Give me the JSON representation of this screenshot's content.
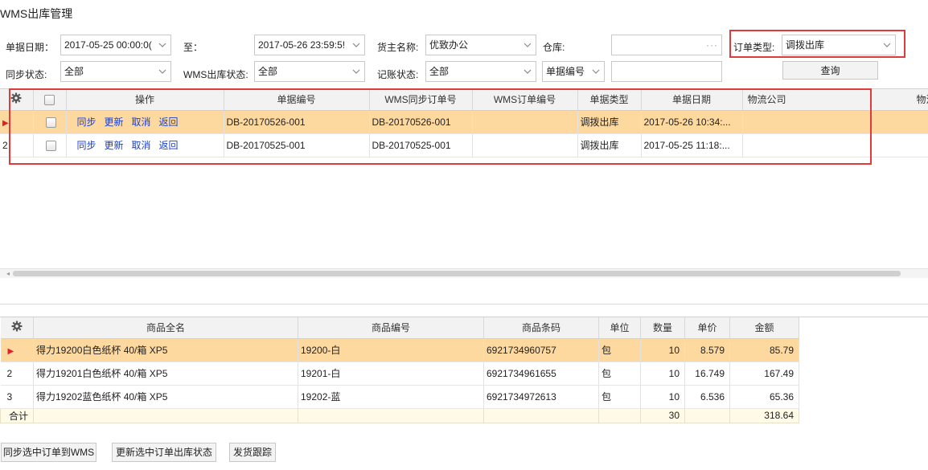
{
  "page_title": "WMS出库管理",
  "filters": {
    "date_from_label": "单据日期：",
    "date_from": "2017-05-25 00:00:0(",
    "date_to_label": "至：",
    "date_to": "2017-05-26 23:59:5!",
    "owner_label": "货主名称:",
    "owner": "优致办公",
    "warehouse_label": "仓库:",
    "warehouse": "",
    "warehouse_ellipsis": "···",
    "order_type_label": "订单类型:",
    "order_type": "调拨出库",
    "sync_status_label": "同步状态:",
    "sync_status": "全部",
    "wms_status_label": "WMS出库状态:",
    "wms_status": "全部",
    "account_status_label": "记账状态:",
    "account_status": "全部",
    "search_field": "单据编号",
    "search_value": "",
    "query_button": "查询"
  },
  "orders": {
    "columns": [
      "操作",
      "单据编号",
      "WMS同步订单号",
      "WMS订单编号",
      "单据类型",
      "单据日期",
      "物流公司",
      "物流单号"
    ],
    "column_last_display": "物流单-",
    "actions": [
      "同步",
      "更新",
      "取消",
      "返回"
    ],
    "rows": [
      {
        "row_no": "1",
        "doc_no": "DB-20170526-001",
        "wms_sync_no": "DB-20170526-001",
        "wms_order_no": "",
        "doc_type": "调拨出库",
        "doc_date": "2017-05-26 10:34:...",
        "logistics": "",
        "tracking": "",
        "selected": true
      },
      {
        "row_no": "2",
        "doc_no": "DB-20170525-001",
        "wms_sync_no": "DB-20170525-001",
        "wms_order_no": "",
        "doc_type": "调拨出库",
        "doc_date": "2017-05-25 11:18:...",
        "logistics": "",
        "tracking": "",
        "selected": false
      }
    ]
  },
  "items": {
    "columns": [
      "商品全名",
      "商品编号",
      "商品条码",
      "单位",
      "数量",
      "单价",
      "金额"
    ],
    "rows": [
      {
        "row_no": "1",
        "name": "得力19200白色纸杯 40/箱 XP5",
        "code": "19200-白",
        "barcode": "6921734960757",
        "unit": "包",
        "qty": "10",
        "price": "8.579",
        "amount": "85.79",
        "selected": true
      },
      {
        "row_no": "2",
        "name": "得力19201白色纸杯 40/箱 XP5",
        "code": "19201-白",
        "barcode": "6921734961655",
        "unit": "包",
        "qty": "10",
        "price": "16.749",
        "amount": "167.49",
        "selected": false
      },
      {
        "row_no": "3",
        "name": "得力19202蓝色纸杯 40/箱 XP5",
        "code": "19202-蓝",
        "barcode": "6921734972613",
        "unit": "包",
        "qty": "10",
        "price": "6.536",
        "amount": "65.36",
        "selected": false
      }
    ],
    "total_label": "合计",
    "total_qty": "30",
    "total_amount": "318.64"
  },
  "footer_buttons": [
    "同步选中订单到WMS",
    "更新选中订单出库状态",
    "发货跟踪"
  ],
  "colors": {
    "highlight_box": "#e23a3a",
    "selected_row": "#fdd9a0",
    "action_link": "#1a3fcc",
    "row_marker": "#e0202a"
  }
}
